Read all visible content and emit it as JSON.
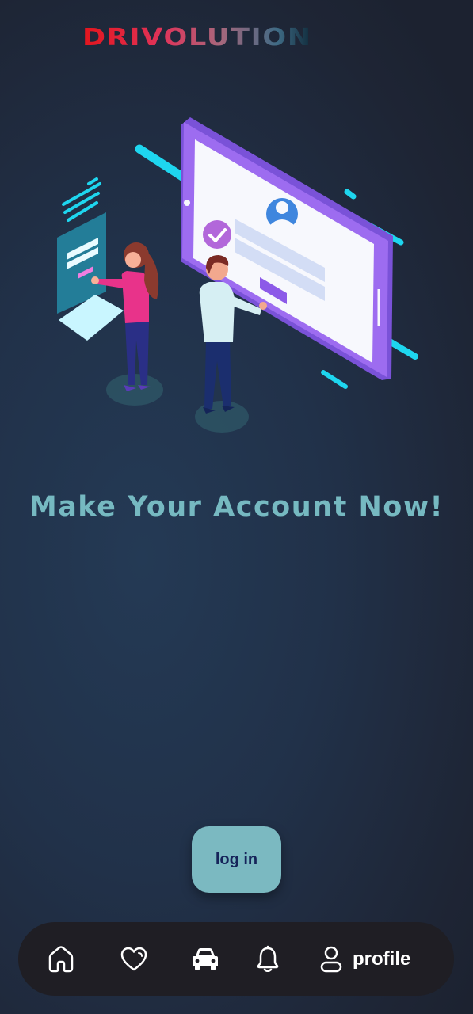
{
  "brand": {
    "logo_text": "DRIVOLUTION",
    "colors": [
      "#e3151d",
      "#e0345a",
      "#a7677c",
      "#3f6b85",
      "#0f2a3a"
    ]
  },
  "hero": {
    "illustration": "account-signup-illustration",
    "headline": "Make Your Account Now!"
  },
  "actions": {
    "login_label": "log in"
  },
  "bottom_nav": {
    "items": [
      {
        "icon": "home-icon"
      },
      {
        "icon": "heart-icon"
      },
      {
        "icon": "car-icon",
        "active": true
      },
      {
        "icon": "bell-icon"
      },
      {
        "icon": "user-icon",
        "label": "profile"
      }
    ]
  },
  "theme": {
    "headline_color": "#76b9c1",
    "button_color": "#7bb9c1",
    "button_text_color": "#16245a",
    "nav_background": "#1f1e24"
  }
}
